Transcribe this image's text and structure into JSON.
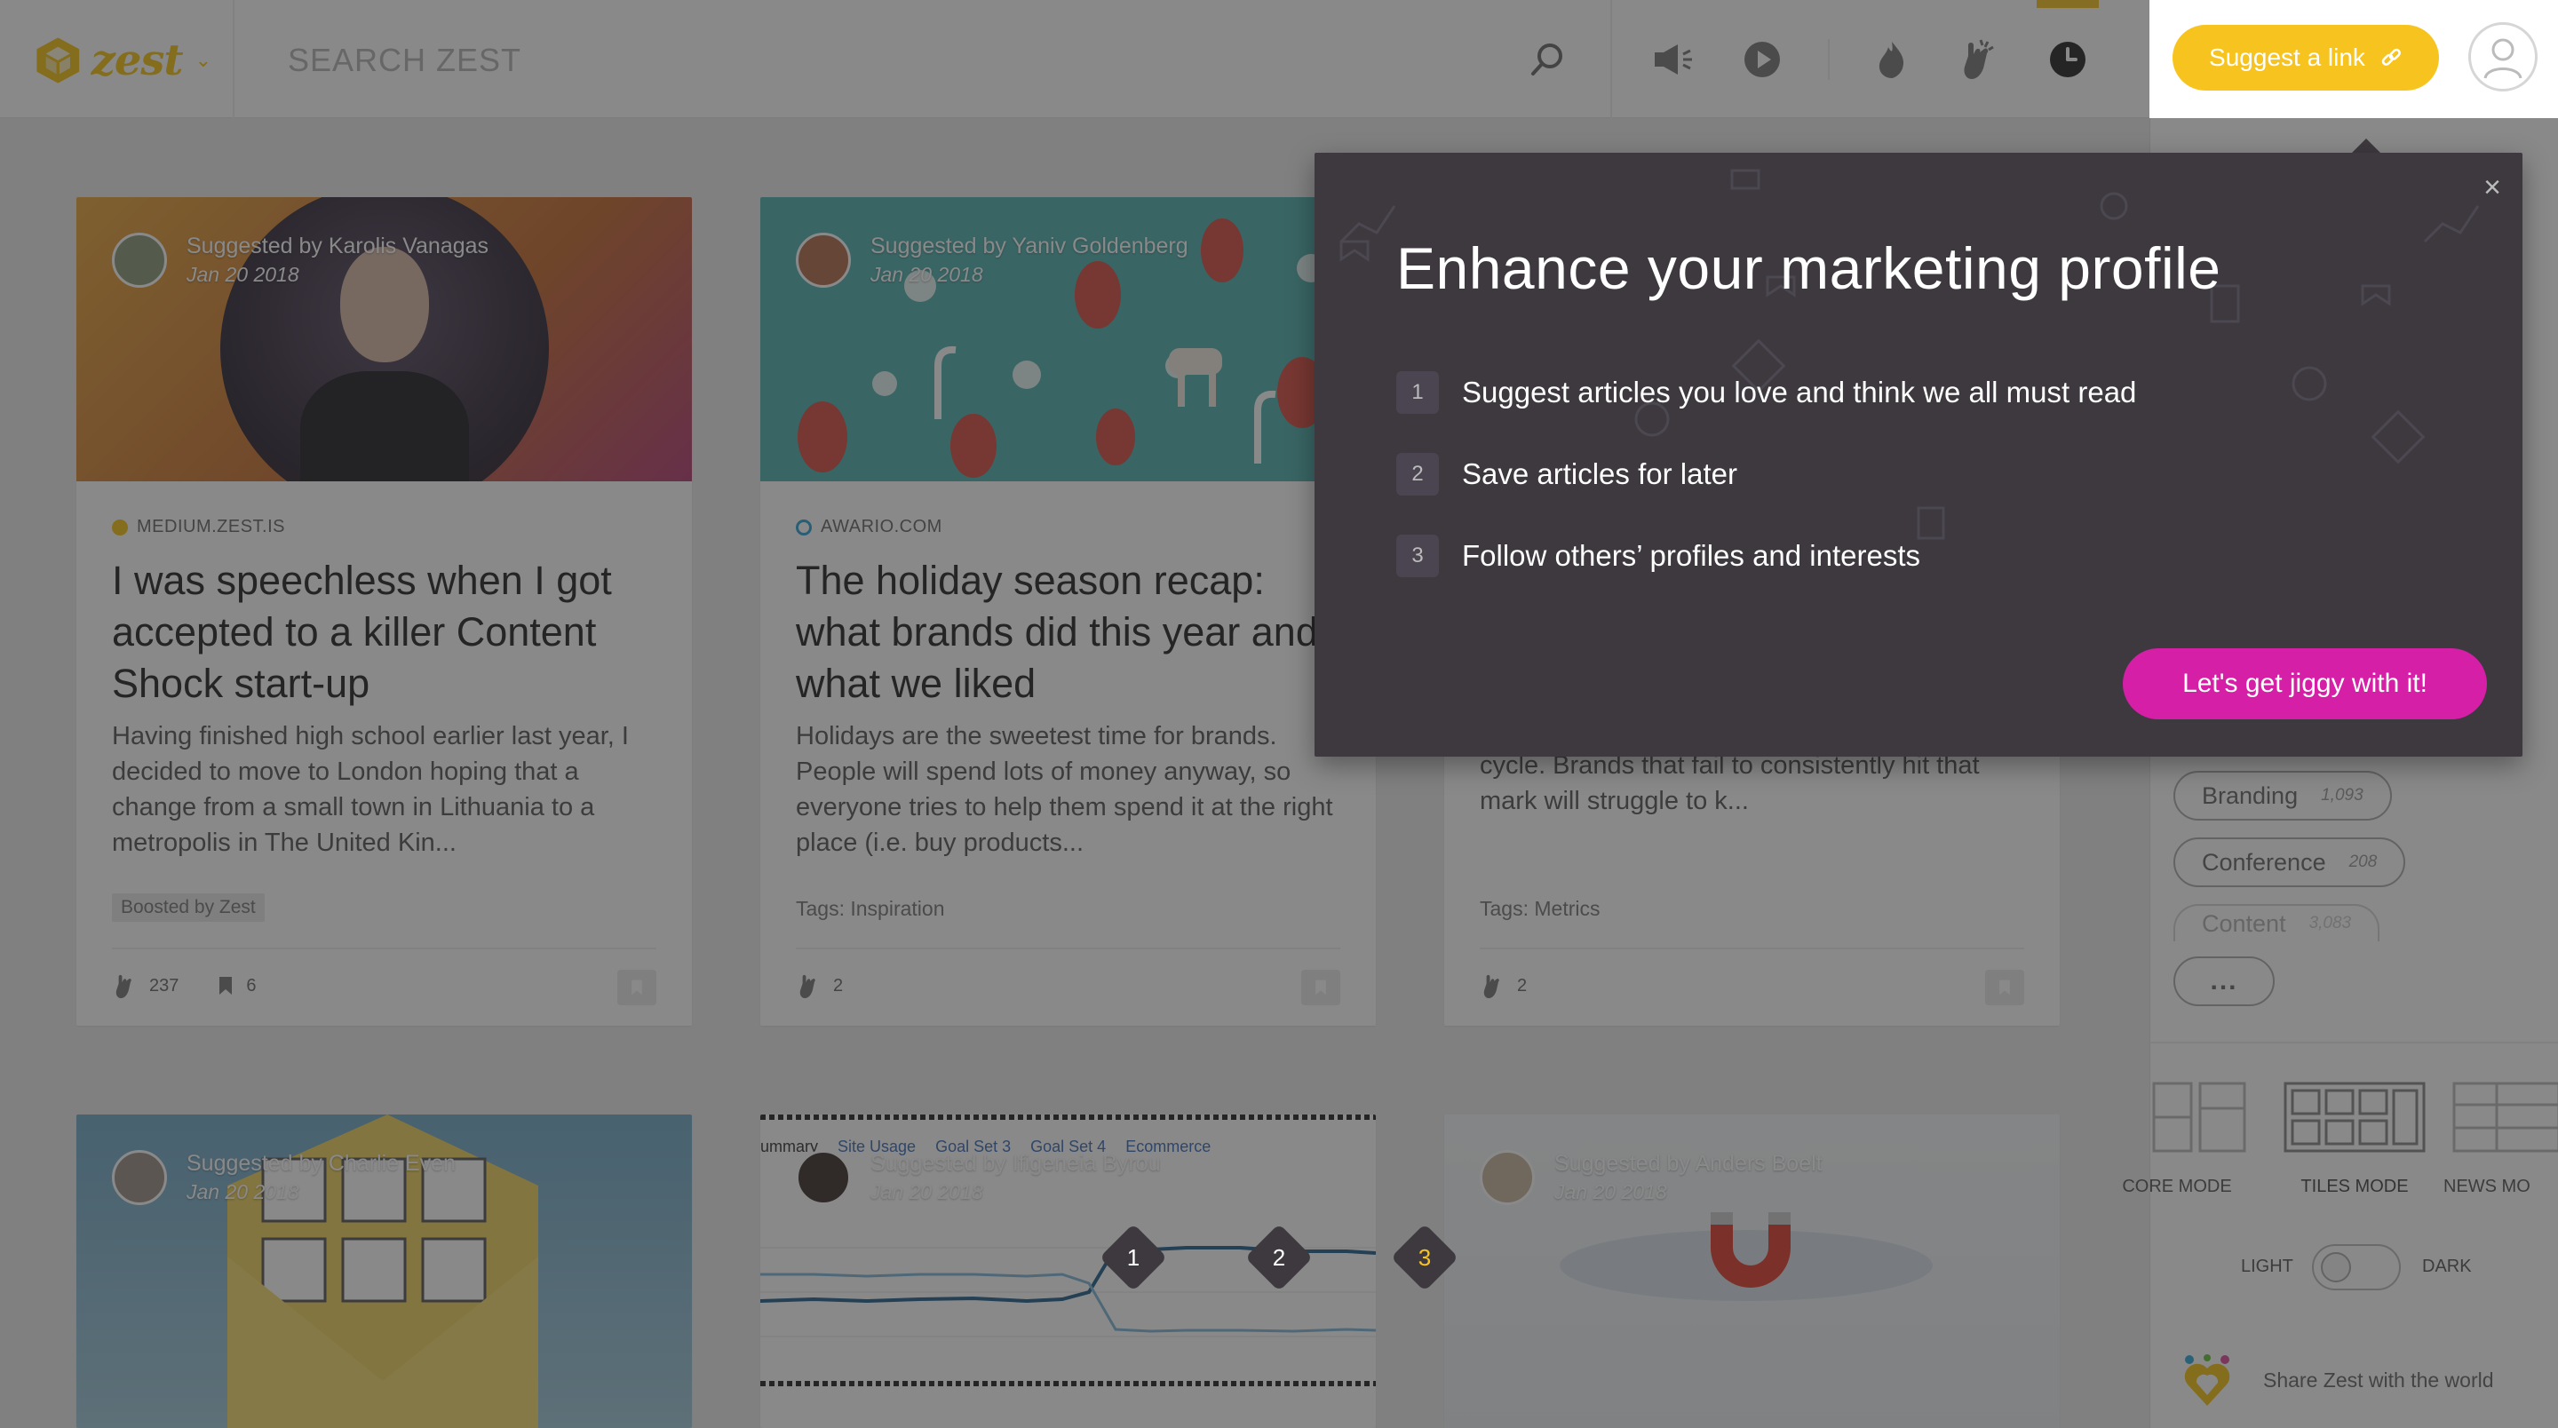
{
  "app": {
    "logo_text": "zest",
    "search": {
      "placeholder": "SEARCH ZEST"
    },
    "suggest_button": "Suggest a link",
    "icons": [
      "search-icon",
      "megaphone-icon",
      "play-icon",
      "flame-icon",
      "clap-icon",
      "clock-icon",
      "link-icon",
      "user-icon"
    ]
  },
  "cards": [
    {
      "suggested_by": "Suggested by Karolis Vanagas",
      "date": "Jan 20 2018",
      "source": "MEDIUM.ZEST.IS",
      "title": "I was speechless when I got accepted to a killer Content Shock start-up",
      "excerpt": "Having finished high school earlier last year, I decided to move to London hoping that a change from a small town in Lithuania to a metropolis in The United Kin...",
      "tag_label": "Boosted by Zest",
      "claps": "237",
      "saves": "6"
    },
    {
      "suggested_by": "Suggested by Yaniv Goldenberg",
      "date": "Jan 20 2018",
      "source": "AWARIO.COM",
      "title": "The holiday season recap: what brands did this year and what we liked",
      "excerpt": "Holidays are the sweetest time for brands. People will spend lots of money anyway, so everyone tries to help them spend it at the right place (i.e. buy products...",
      "tags_prefix": "Tags:",
      "tags": "Inspiration",
      "claps": "2"
    },
    {
      "excerpt_tail": "cycle. Brands that fail to consistently hit that mark will struggle to k...",
      "tags_prefix": "Tags:",
      "tags": "Metrics",
      "claps": "2"
    },
    {
      "suggested_by": "Suggested by Charlie Even",
      "date": "Jan 20 2018"
    },
    {
      "suggested_by": "Suggested by Ifigeneia Byrou",
      "date": "Jan 20 2018",
      "chart_labels": [
        "ummary",
        "Site Usage",
        "Goal Set 3",
        "Goal Set 4",
        "Ecommerce"
      ]
    },
    {
      "suggested_by": "Suggested by Anders Boelt",
      "date": "Jan 20 2018"
    }
  ],
  "sidebar": {
    "tags": [
      {
        "label": "Branding",
        "count": "1,093"
      },
      {
        "label": "Conference",
        "count": "208"
      },
      {
        "label": "Content",
        "count": "3,083"
      }
    ],
    "more_label": "...",
    "modes": [
      "CORE MODE",
      "TILES MODE",
      "NEWS MO"
    ],
    "theme_light": "LIGHT",
    "theme_dark": "DARK",
    "share_text": "Share Zest with the world"
  },
  "popup": {
    "title": "Enhance your marketing profile",
    "steps": [
      {
        "n": "1",
        "text": "Suggest articles you love and think we all must read"
      },
      {
        "n": "2",
        "text": "Save articles for later"
      },
      {
        "n": "3",
        "text": "Follow others’ profiles and interests"
      }
    ],
    "cta": "Let's get jiggy with it!",
    "close": "×"
  },
  "walkthrough": {
    "markers": [
      "1",
      "2",
      "3"
    ]
  },
  "colors": {
    "brand_yellow": "#f7c41f",
    "cta_magenta": "#d51fa7",
    "popup_bg": "#3d393f"
  }
}
